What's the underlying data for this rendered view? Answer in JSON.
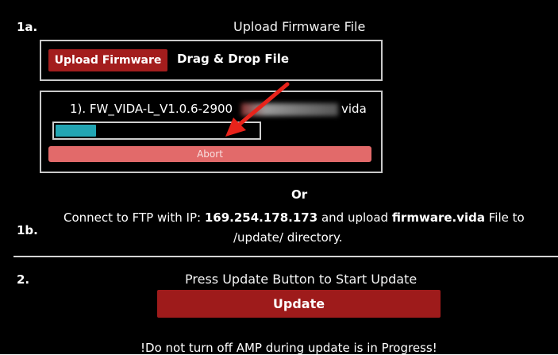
{
  "step1a": {
    "label": "1a.",
    "title": "Upload Firmware File",
    "upload_button": "Upload Firmware",
    "drag_drop": "Drag & Drop File",
    "file": {
      "prefix": "1). FW_VIDA-L_V1.0.6-2900",
      "suffix": "vida",
      "progress_fraction": 0.2
    },
    "abort_button": "Abort"
  },
  "or_text": "Or",
  "step1b": {
    "label": "1b.",
    "line1_pre": "Connect to FTP with IP: ",
    "ip": "169.254.178.173",
    "line1_mid": " and upload ",
    "filename": "firmware.vida",
    "line1_post": " File to",
    "line2": "/update/ directory."
  },
  "step2": {
    "label": "2.",
    "title": "Press Update Button to Start Update",
    "update_button": "Update",
    "warning": "!Do not turn off AMP during update is in Progress!"
  },
  "colors": {
    "background": "#000000",
    "button_red": "#a31d1d",
    "abort_red": "#e26a6a",
    "progress": "#23a5b3",
    "annotation_arrow": "#e8231b"
  },
  "icons": {
    "annotation": "red-arrow-icon"
  }
}
